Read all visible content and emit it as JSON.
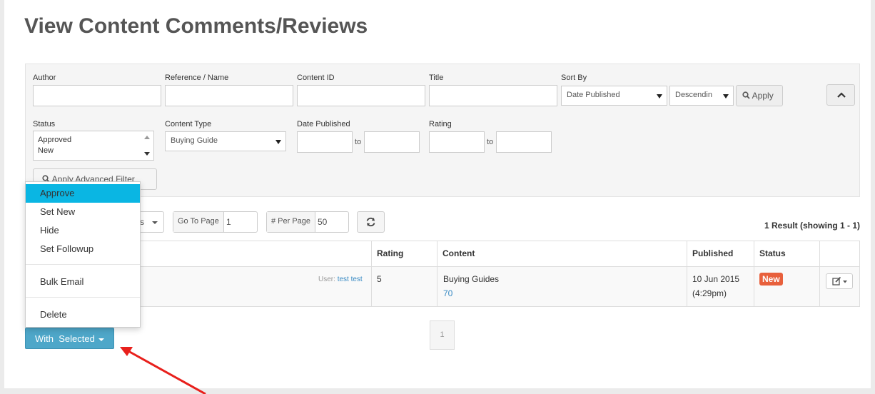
{
  "page": {
    "title": "View Content Comments/Reviews"
  },
  "filters": {
    "author_label": "Author",
    "reference_label": "Reference / Name",
    "content_id_label": "Content ID",
    "title_label": "Title",
    "sort_by_label": "Sort By",
    "sort_by_value": "Date Published",
    "sort_order_value": "Descendin",
    "apply_label": "Apply",
    "status_label": "Status",
    "status_options": [
      "Approved",
      "New"
    ],
    "content_type_label": "Content Type",
    "content_type_value": "Buying Guide",
    "date_published_label": "Date Published",
    "to_label": "to",
    "rating_label": "Rating",
    "advanced_apply_label": "Apply Advanced Filter"
  },
  "toolbar": {
    "filters_partial": "s",
    "go_to_page_label": "Go To Page",
    "go_to_page_value": "1",
    "per_page_label": "# Per Page",
    "per_page_value": "50",
    "result_text": "1 Result (showing 1 - 1)"
  },
  "table": {
    "columns": [
      "Rating",
      "Content",
      "Published",
      "Status"
    ],
    "rows": [
      {
        "user_prefix": "User:",
        "user_name": "test test",
        "rating": "5",
        "content_title": "Buying Guides",
        "content_id": "70",
        "published_date": "10 Jun 2015",
        "published_time": "(4:29pm)",
        "status": "New"
      }
    ]
  },
  "pagination": {
    "current": "1"
  },
  "bulk": {
    "button_label": "With  Selected",
    "menu": [
      "Approve",
      "Set New",
      "Hide",
      "Set Followup",
      "Bulk Email",
      "Delete"
    ],
    "active_item": "Approve"
  },
  "colors": {
    "accent": "#0ab6e3",
    "with_selected": "#4ea7c9",
    "badge_new": "#e8603c",
    "annotation_arrow": "#e8201c"
  }
}
